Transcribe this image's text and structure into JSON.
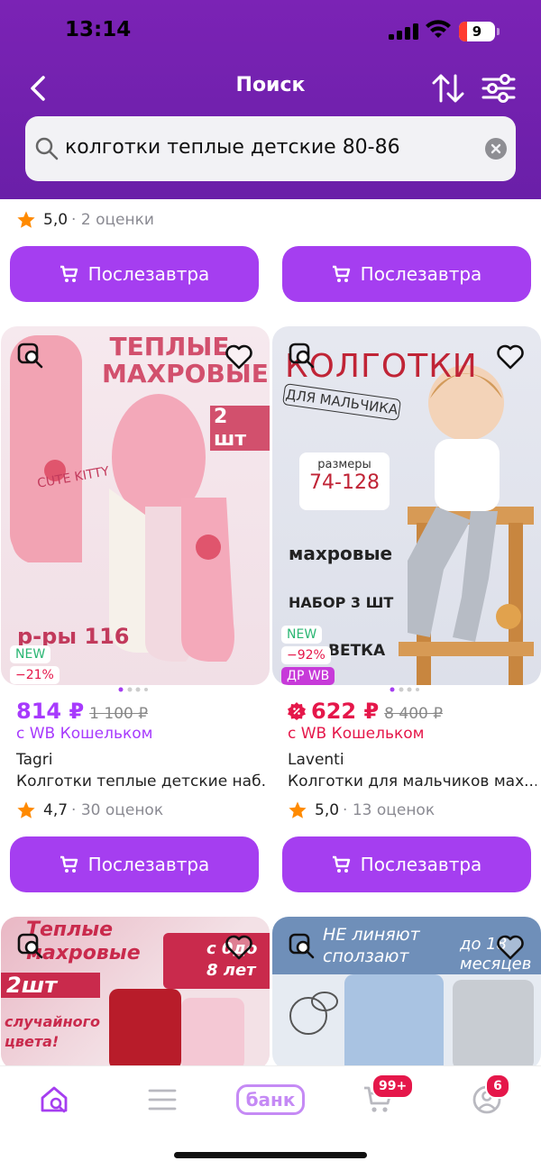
{
  "status": {
    "time": "13:14",
    "battery": "9"
  },
  "nav": {
    "title": "Поиск"
  },
  "search": {
    "query": "колготки теплые детские 80-86"
  },
  "top_row": {
    "rating_score": "5,0",
    "rating_count": "· 2 оценки",
    "button_label": "Послезавтра"
  },
  "products": [
    {
      "images": {
        "headline": "ТЕПЛЫЕ МАХРОВЫЕ",
        "badge_text": "2 шт",
        "motif": "CUTE KITTY",
        "size_text": "р-ры 116"
      },
      "badges": {
        "new": "NEW",
        "discount": "−21%"
      },
      "price": "814 ₽",
      "old_price": "1 100 ₽",
      "wallet": "с WB Кошельком",
      "brand": "Tagri",
      "title": "Колготки теплые детские наб...",
      "rating_score": "4,7",
      "rating_count": "· 30 оценок",
      "button_label": "Послезавтра"
    },
    {
      "images": {
        "headline": "КОЛГОТКИ",
        "tag": "ДЛЯ МАЛЬЧИКА",
        "sizes_label": "размеры",
        "sizes": "74-128",
        "feature1": "махровые",
        "feature2": "НАБОР 3 ШТ",
        "feature3": "ВЕТКА"
      },
      "badges": {
        "new": "NEW",
        "discount": "−92%",
        "promo": "ДР WB"
      },
      "price": "622 ₽",
      "old_price": "8 400 ₽",
      "wallet": "с WB Кошельком",
      "brand": "Laventi",
      "title": "Колготки для мальчиков мах...",
      "rating_score": "5,0",
      "rating_count": "· 13 оценок",
      "button_label": "Послезавтра"
    }
  ],
  "bottom_row": [
    {
      "headline": "Теплые махровые",
      "line2": "2шт",
      "line3": "случайного цвета!",
      "age": "с 0до 8 лет"
    },
    {
      "headline": "НЕ линяют сползают",
      "age": "до 18 месяцев"
    }
  ],
  "tabbar": {
    "bank_label": "банк",
    "cart_badge": "99+",
    "profile_badge": "6"
  },
  "colors": {
    "header": "#7b23b5",
    "accent": "#a53ef0",
    "price": "#a73afd",
    "badge_red": "#e5174a",
    "new_green": "#2ab673"
  }
}
